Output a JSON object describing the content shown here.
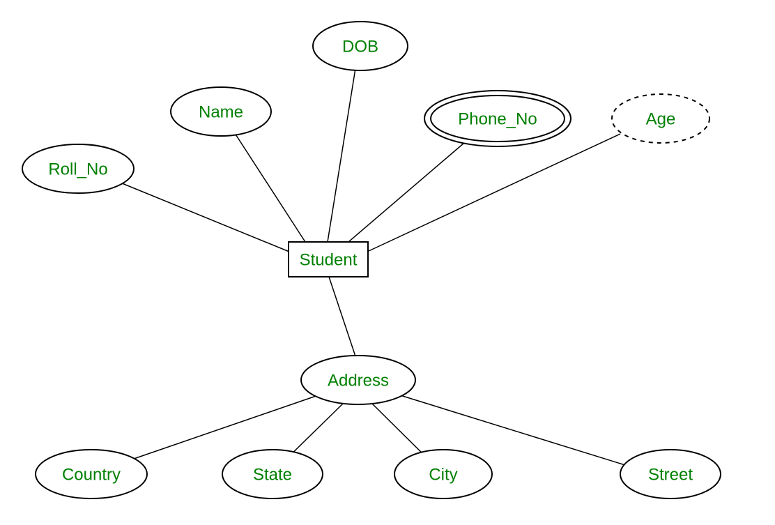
{
  "entity": {
    "student": "Student"
  },
  "attributes": {
    "roll_no": "Roll_No",
    "name": "Name",
    "dob": "DOB",
    "phone_no": "Phone_No",
    "age": "Age",
    "address": "Address",
    "country": "Country",
    "state": "State",
    "city": "City",
    "street": "Street"
  }
}
